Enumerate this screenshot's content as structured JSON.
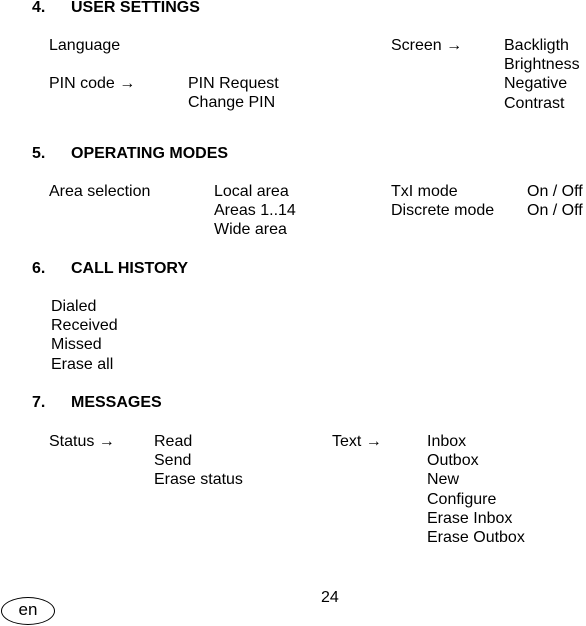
{
  "sections": {
    "user_settings": {
      "number": "4.",
      "title": "USER SETTINGS",
      "language": "Language",
      "pin_code": "PIN code →",
      "pin_items": [
        "PIN Request",
        "Change PIN"
      ],
      "screen": "Screen →",
      "screen_items": [
        "Backligth",
        "Brightness",
        "Negative",
        "Contrast"
      ]
    },
    "operating_modes": {
      "number": "5.",
      "title": "OPERATING MODES",
      "area_selection": "Area selection",
      "area_items": [
        "Local area",
        "Areas 1..14",
        "Wide area"
      ],
      "modes": [
        "TxI mode",
        "Discrete mode"
      ],
      "mode_values": [
        "On / Off",
        "On / Off"
      ]
    },
    "call_history": {
      "number": "6.",
      "title": "CALL HISTORY",
      "items": [
        "Dialed",
        "Received",
        "Missed",
        "Erase all"
      ]
    },
    "messages": {
      "number": "7.",
      "title": "MESSAGES",
      "status": "Status →",
      "status_items": [
        "Read",
        "Send",
        "Erase status"
      ],
      "text": "Text →",
      "text_items": [
        "Inbox",
        "Outbox",
        "New",
        "Configure",
        "Erase Inbox",
        "Erase Outbox"
      ]
    }
  },
  "footer": {
    "page_number": "24",
    "language_badge": "en"
  }
}
